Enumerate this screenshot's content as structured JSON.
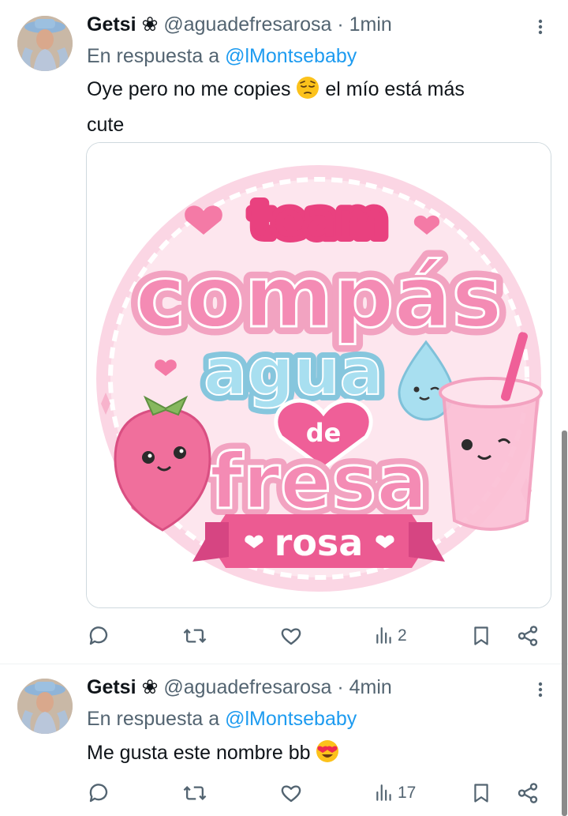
{
  "tweets": [
    {
      "name": "Getsi ❀",
      "handle": "@aguadefresarosa",
      "time": "· 1min",
      "reply_prefix": "En respuesta a",
      "reply_to": "@lMontsebaby",
      "text_before_emoji": "Oye pero no me copies",
      "emoji": "pensive-face",
      "text_after_emoji": "el mío está más",
      "text_line2": "cute",
      "views": "2"
    },
    {
      "name": "Getsi ❀",
      "handle": "@aguadefresarosa",
      "time": "· 4min",
      "reply_prefix": "En respuesta a",
      "reply_to": "@lMontsebaby",
      "text_before_emoji": "Me gusta este nombre bb",
      "emoji": "heart-eyes-face",
      "views": "17"
    }
  ],
  "media": {
    "logo_line1": "team",
    "logo_line2": "compás",
    "logo_line3": "agua",
    "logo_line4": "de",
    "logo_line5": "fresa",
    "logo_ribbon": "rosa"
  },
  "colors": {
    "link": "#1d9bf0",
    "muted": "#536471",
    "pink": "#f48bb4",
    "light_blue": "#a8dff0"
  }
}
